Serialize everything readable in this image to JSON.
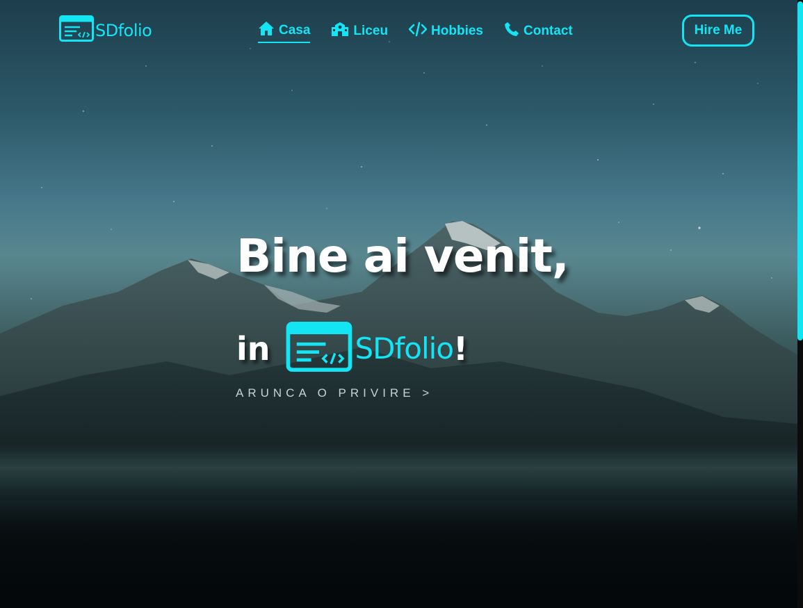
{
  "brand": {
    "name": "SDfolio",
    "logo_icon": "code-window-icon"
  },
  "nav": {
    "links": [
      {
        "label": "Casa",
        "icon": "home-icon",
        "active": true
      },
      {
        "label": "Liceu",
        "icon": "school-icon",
        "active": false
      },
      {
        "label": "Hobbies",
        "icon": "code-icon",
        "active": false
      },
      {
        "label": "Contact",
        "icon": "phone-icon",
        "active": false
      }
    ],
    "cta_label": "Hire Me"
  },
  "hero": {
    "headline": "Bine ai venit,",
    "sub_prefix": "in",
    "sub_brand": "SDfolio",
    "sub_suffix": "!",
    "cta": "ARUNCA O PRIVIRE >"
  },
  "colors": {
    "accent": "#14e5f5",
    "text": "#ffffff",
    "muted": "#c7d2d4"
  }
}
